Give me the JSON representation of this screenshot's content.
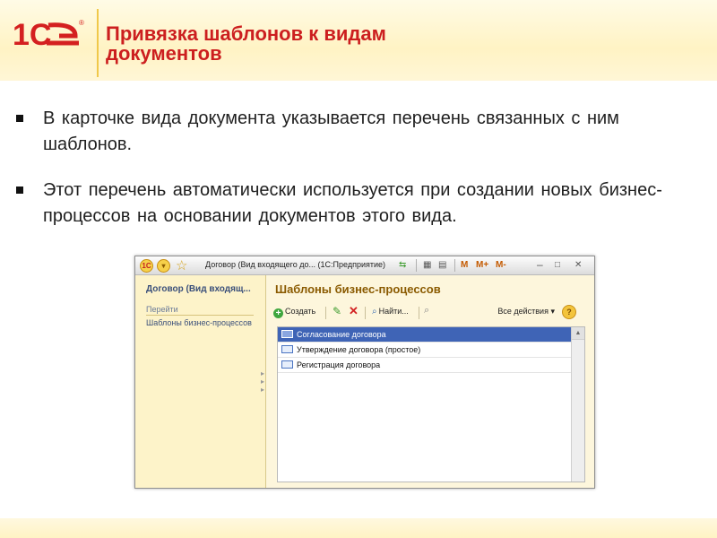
{
  "slide": {
    "title": "Привязка шаблонов к видам документов",
    "bullets": [
      "В карточке вида документа указывается перечень связанных с ним шаблонов.",
      "Этот перечень автоматически используется при создании новых бизнес-процессов на основании документов этого вида."
    ]
  },
  "logo": {
    "text": "1С",
    "reg": "®"
  },
  "window": {
    "title": "Договор (Вид входящего до... (1С:Предприятие)",
    "toolbar_m": "M",
    "toolbar_mplus": "M+",
    "toolbar_mminus": "M-",
    "icons": [
      "app-icon",
      "dropdown-icon",
      "star-icon",
      "history-icon",
      "calendar-icon",
      "calculator-icon",
      "minimize-icon",
      "maximize-icon",
      "close-icon"
    ]
  },
  "left_panel": {
    "doc_name": "Договор (Вид входящ...",
    "nav_header": "Перейти",
    "nav_items": [
      "Шаблоны бизнес-процессов"
    ]
  },
  "form": {
    "title": "Шаблоны бизнес-процессов",
    "toolbar": {
      "create": "Создать",
      "find": "Найти...",
      "all_actions": "Все действия"
    },
    "rows": [
      {
        "label": "Согласование договора",
        "selected": true
      },
      {
        "label": "Утверждение договора (простое)",
        "selected": false
      },
      {
        "label": "Регистрация договора",
        "selected": false
      }
    ]
  },
  "colors": {
    "title_red": "#cc1f1f",
    "header_yellow": "#fff3c4",
    "form_title_brown": "#8a5a00",
    "selection_blue": "#3f64b6"
  }
}
